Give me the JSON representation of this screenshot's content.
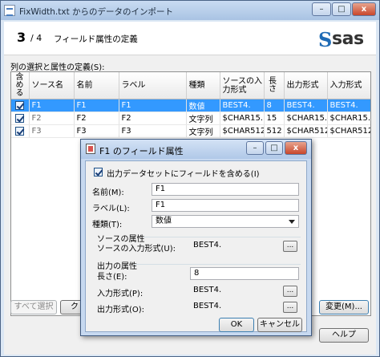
{
  "window": {
    "title": "FixWidth.txt からのデータのインポート",
    "minimize": "–",
    "maximize": "□",
    "close": "x"
  },
  "header": {
    "step_current": "3",
    "step_total": "/ 4",
    "step_title": "フィールド属性の定義",
    "logo_s": "S",
    "logo_text": "sas"
  },
  "grid": {
    "label": "列の選択と属性の定義(S):",
    "columns": [
      "含める",
      "ソース名",
      "名前",
      "ラベル",
      "種類",
      "ソースの入力形式",
      "長さ",
      "出力形式",
      "入力形式"
    ],
    "rows": [
      {
        "include": true,
        "source": "F1",
        "name": "F1",
        "label": "F1",
        "type": "数値",
        "src_informat": "BEST4.",
        "length": "8",
        "format": "BEST4.",
        "informat": "BEST4."
      },
      {
        "include": true,
        "source": "F2",
        "name": "F2",
        "label": "F2",
        "type": "文字列",
        "src_informat": "$CHAR15.",
        "length": "15",
        "format": "$CHAR15.",
        "informat": "$CHAR15."
      },
      {
        "include": true,
        "source": "F3",
        "name": "F3",
        "label": "F3",
        "type": "文字列",
        "src_informat": "$CHAR512.",
        "length": "512",
        "format": "$CHAR512.",
        "informat": "$CHAR512."
      }
    ]
  },
  "bottom_buttons": {
    "select_all": "すべて選択",
    "clear_partial": "ク",
    "change": "変更(M)...",
    "help": "ヘルプ"
  },
  "dialog": {
    "title": "F1 のフィールド属性",
    "include_label": "出力データセットにフィールドを含める(I)",
    "include_checked": true,
    "name_label": "名前(M):",
    "name_value": "F1",
    "label_label": "ラベル(L):",
    "label_value": "F1",
    "type_label": "種類(T):",
    "type_value": "数値",
    "source_group": "ソースの属性",
    "src_informat_label": "ソースの入力形式(U):",
    "src_informat_value": "BEST4.",
    "output_group": "出力の属性",
    "length_label": "長さ(E):",
    "length_value": "8",
    "informat_label": "入力形式(P):",
    "informat_value": "BEST4.",
    "format_label": "出力形式(O):",
    "format_value": "BEST4.",
    "browse": "...",
    "ok": "OK",
    "cancel": "キャンセル",
    "minimize": "–",
    "maximize": "□",
    "close": "x"
  }
}
